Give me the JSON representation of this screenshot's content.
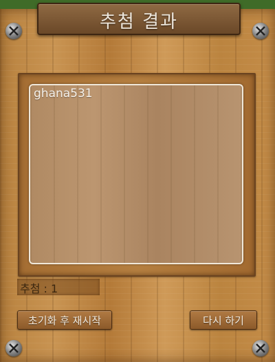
{
  "header": {
    "title": "추첨 결과"
  },
  "result": {
    "winners": [
      "ghana531"
    ]
  },
  "summary": {
    "draw_count_text": "추첨 : 1"
  },
  "buttons": {
    "reset_restart": "초기화 후 재시작",
    "draw_again": "다시 하기"
  },
  "icons": {
    "corners": [
      "screw-icon",
      "screw-icon",
      "screw-icon",
      "screw-icon"
    ]
  },
  "colors": {
    "wood": "#c48c48",
    "panel_border": "#f0e8da",
    "button": "#8c5a2a"
  }
}
